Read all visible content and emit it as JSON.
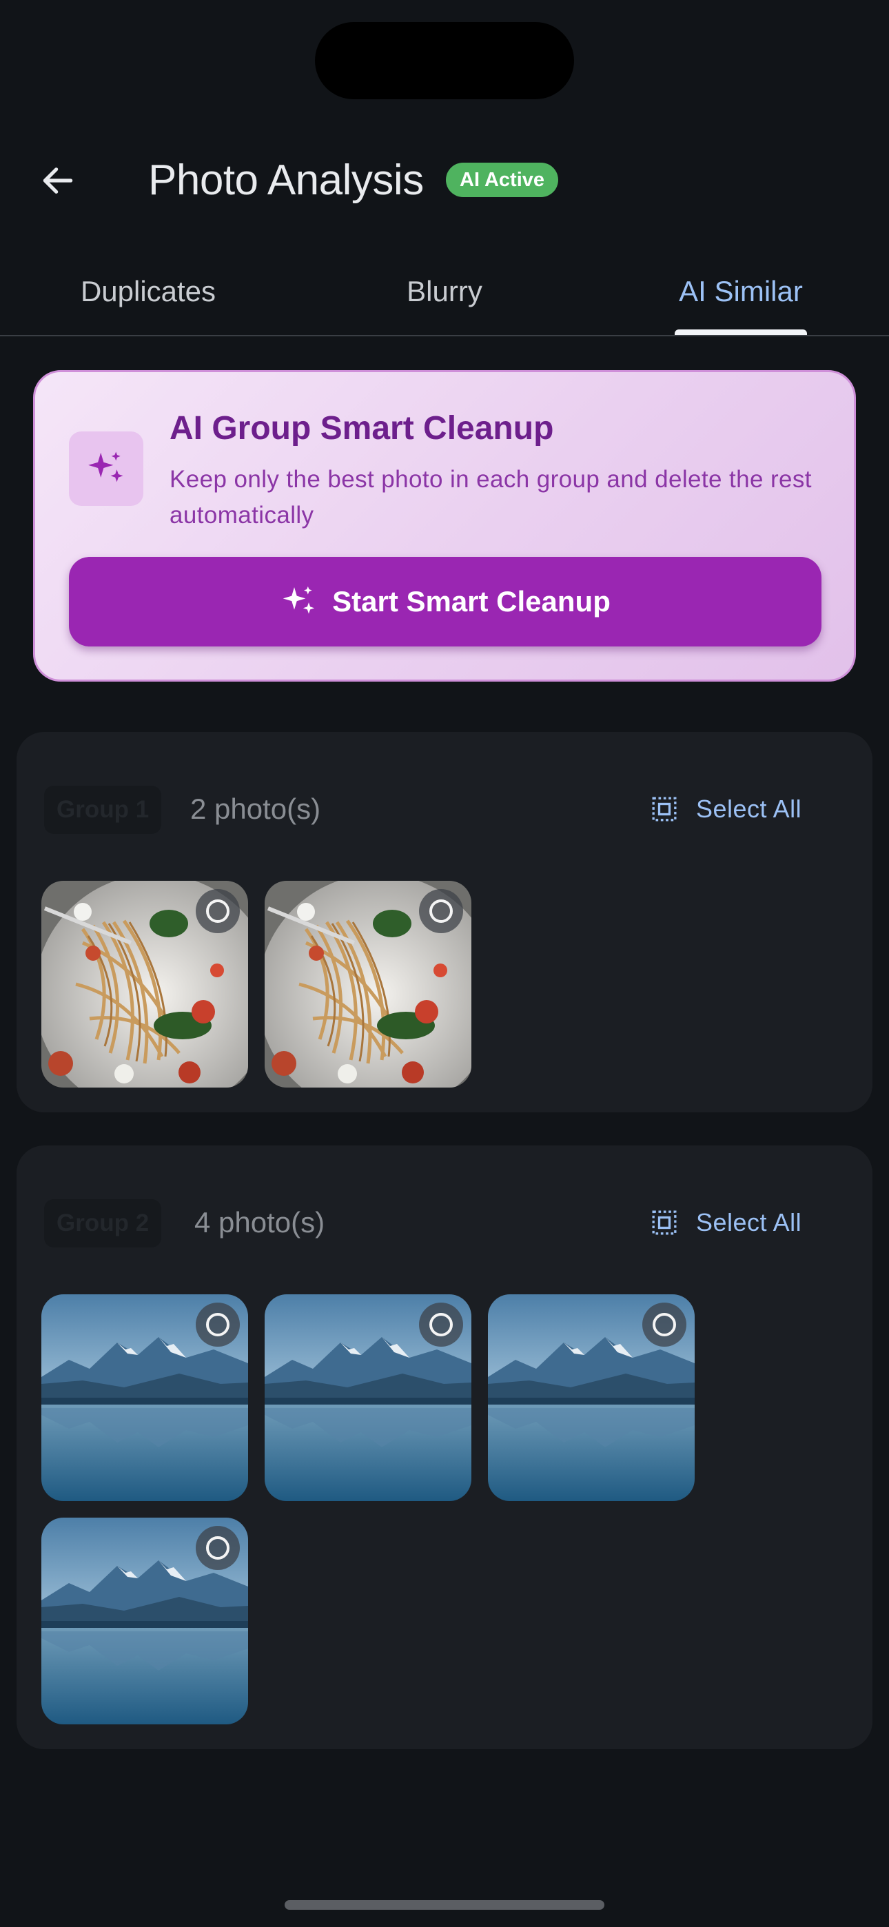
{
  "header": {
    "title": "Photo Analysis",
    "badge": "AI Active",
    "back_icon": "arrow-left-icon"
  },
  "tabs": [
    {
      "label": "Duplicates",
      "active": false
    },
    {
      "label": "Blurry",
      "active": false
    },
    {
      "label": "AI Similar",
      "active": true
    }
  ],
  "promo": {
    "icon": "sparkles-icon",
    "title": "AI Group Smart Cleanup",
    "description": "Keep only the best photo in each group and delete the rest automatically",
    "button_label": "Start Smart Cleanup"
  },
  "groups": [
    {
      "label": "Group 1",
      "count_text": "2 photo(s)",
      "select_all_label": "Select All",
      "photos": [
        {
          "subject": "pasta-dish",
          "selected": false
        },
        {
          "subject": "pasta-dish",
          "selected": false
        }
      ]
    },
    {
      "label": "Group 2",
      "count_text": "4 photo(s)",
      "select_all_label": "Select All",
      "photos": [
        {
          "subject": "mountain-lake",
          "selected": false
        },
        {
          "subject": "mountain-lake",
          "selected": false
        },
        {
          "subject": "mountain-lake",
          "selected": false
        },
        {
          "subject": "mountain-lake",
          "selected": false
        }
      ]
    }
  ],
  "colors": {
    "background": "#111418",
    "accent_blue": "#9cc1f5",
    "badge_green": "#4fb35f",
    "promo_purple": "#9a26b2",
    "card": "#1b1e23"
  }
}
